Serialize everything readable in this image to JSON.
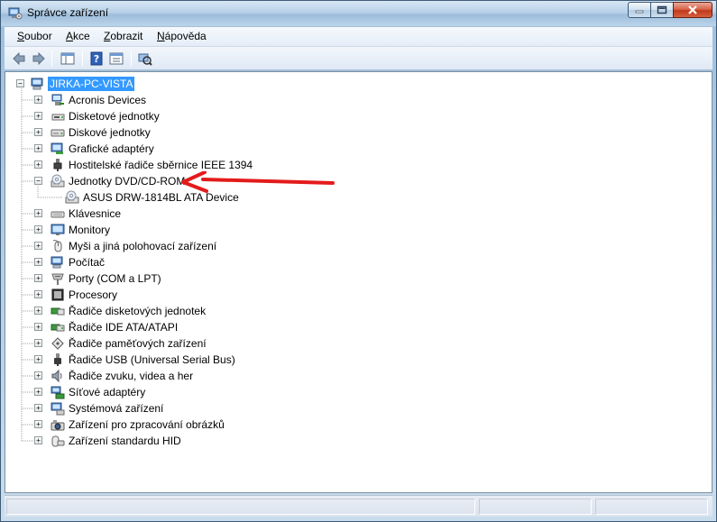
{
  "window": {
    "title": "Správce zařízení"
  },
  "menu": {
    "items": [
      {
        "key": "S",
        "rest": "oubor"
      },
      {
        "key": "A",
        "rest": "kce"
      },
      {
        "key": "Z",
        "rest": "obrazit"
      },
      {
        "key": "N",
        "rest": "ápověda"
      }
    ]
  },
  "toolbar": {
    "buttons": [
      "back-icon",
      "forward-icon",
      "show-hide-console-tree-icon",
      "help-icon",
      "properties-icon",
      "scan-hardware-icon"
    ]
  },
  "tree": {
    "root": "JIRKA-PC-VISTA",
    "categories": [
      {
        "label": "Acronis Devices",
        "icon": "device-icon",
        "expander": "+"
      },
      {
        "label": "Disketové jednotky",
        "icon": "floppy-icon",
        "expander": "+"
      },
      {
        "label": "Diskové jednotky",
        "icon": "disk-drive-icon",
        "expander": "+"
      },
      {
        "label": "Grafické adaptéry",
        "icon": "display-adapter-icon",
        "expander": "+"
      },
      {
        "label": "Hostitelské řadiče sběrnice IEEE 1394",
        "icon": "ieee1394-icon",
        "expander": "+"
      },
      {
        "label": "Jednotky DVD/CD-ROM",
        "icon": "dvd-drive-icon",
        "expander": "−"
      },
      {
        "label": "ASUS DRW-1814BL ATA Device",
        "icon": "dvd-drive-icon",
        "child": true
      },
      {
        "label": "Klávesnice",
        "icon": "keyboard-icon",
        "expander": "+"
      },
      {
        "label": "Monitory",
        "icon": "monitor-icon",
        "expander": "+"
      },
      {
        "label": "Myši a jiná polohovací zařízení",
        "icon": "mouse-icon",
        "expander": "+"
      },
      {
        "label": "Počítač",
        "icon": "computer-icon",
        "expander": "+"
      },
      {
        "label": "Porty (COM a LPT)",
        "icon": "port-icon",
        "expander": "+"
      },
      {
        "label": "Procesory",
        "icon": "processor-icon",
        "expander": "+"
      },
      {
        "label": "Řadiče disketových jednotek",
        "icon": "floppy-controller-icon",
        "expander": "+"
      },
      {
        "label": "Řadiče IDE ATA/ATAPI",
        "icon": "ide-controller-icon",
        "expander": "+"
      },
      {
        "label": "Řadiče paměťových zařízení",
        "icon": "storage-controller-icon",
        "expander": "+"
      },
      {
        "label": "Řadiče USB (Universal Serial Bus)",
        "icon": "usb-icon",
        "expander": "+"
      },
      {
        "label": "Řadiče zvuku, videa a her",
        "icon": "sound-icon",
        "expander": "+"
      },
      {
        "label": "Síťové adaptéry",
        "icon": "network-adapter-icon",
        "expander": "+"
      },
      {
        "label": "Systémová zařízení",
        "icon": "system-device-icon",
        "expander": "+"
      },
      {
        "label": "Zařízení pro zpracování obrázků",
        "icon": "imaging-device-icon",
        "expander": "+"
      },
      {
        "label": "Zařízení standardu HID",
        "icon": "hid-icon",
        "expander": "+"
      }
    ]
  },
  "annotation": {
    "arrow": "red-arrow-icon",
    "color": "#e31b1b"
  },
  "colors": {
    "selection": "#3399ff"
  }
}
